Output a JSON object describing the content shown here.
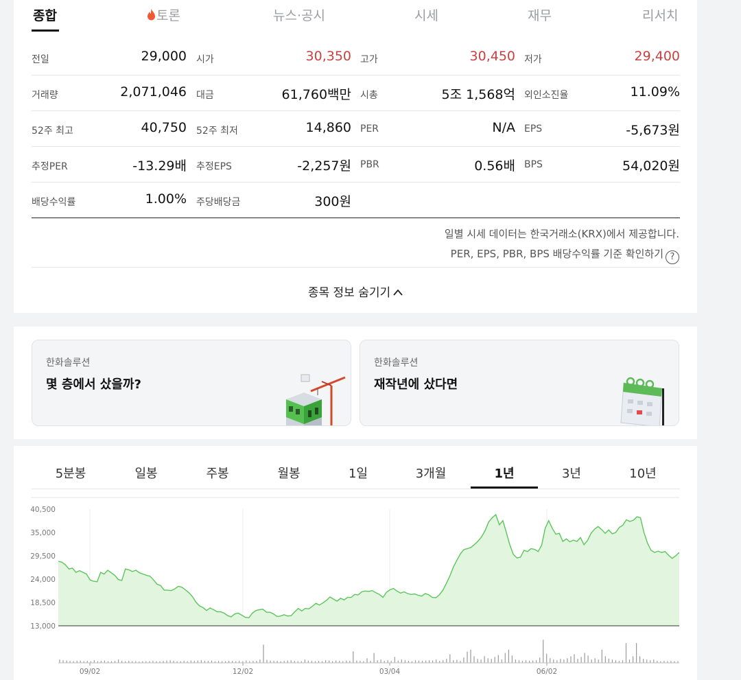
{
  "tabs": [
    {
      "label": "종합",
      "active": true
    },
    {
      "label": "토론",
      "active": false,
      "icon": "fire-icon"
    },
    {
      "label": "뉴스·공시",
      "active": false
    },
    {
      "label": "시세",
      "active": false
    },
    {
      "label": "재무",
      "active": false
    },
    {
      "label": "리서치",
      "active": false
    }
  ],
  "stats": [
    [
      {
        "label": "전일",
        "value": "29,000"
      },
      {
        "label": "시가",
        "value": "30,350",
        "up": true
      },
      {
        "label": "고가",
        "value": "30,450",
        "up": true
      },
      {
        "label": "저가",
        "value": "29,400",
        "up": true
      }
    ],
    [
      {
        "label": "거래량",
        "value": "2,071,046"
      },
      {
        "label": "대금",
        "value": "61,760백만"
      },
      {
        "label": "시총",
        "value": "5조 1,568억"
      },
      {
        "label": "외인소진율",
        "value": "11.09%"
      }
    ],
    [
      {
        "label": "52주 최고",
        "value": "40,750"
      },
      {
        "label": "52주 최저",
        "value": "14,860"
      },
      {
        "label": "PER",
        "value": "N/A"
      },
      {
        "label": "EPS",
        "value": "-5,673원"
      }
    ],
    [
      {
        "label": "추정PER",
        "value": "-13.29배"
      },
      {
        "label": "추정EPS",
        "value": "-2,257원"
      },
      {
        "label": "PBR",
        "value": "0.56배"
      },
      {
        "label": "BPS",
        "value": "54,020원"
      }
    ],
    [
      {
        "label": "배당수익률",
        "value": "1.00%"
      },
      {
        "label": "주당배당금",
        "value": "300원"
      }
    ]
  ],
  "colors": {
    "up": "#c8413f",
    "chart_line": "#5cc55c",
    "chart_fill": "#e1f5df"
  },
  "notes": {
    "source": "일별 시세 데이터는 한국거래소(KRX)에서 제공합니다.",
    "ratio_link": "PER, EPS, PBR, BPS 배당수익률 기준 확인하기",
    "ratio_icon": "question-icon"
  },
  "toggle_label": "종목 정보 숨기기",
  "promos": [
    {
      "brand": "한화솔루션",
      "title": "몇 층에서 샀을까?",
      "icon": "building-crane-icon"
    },
    {
      "brand": "한화솔루션",
      "title": "재작년에 샀다면",
      "icon": "calendar-icon"
    }
  ],
  "period_tabs": [
    {
      "label": "5분봉",
      "active": false
    },
    {
      "label": "일봉",
      "active": false
    },
    {
      "label": "주봉",
      "active": false
    },
    {
      "label": "월봉",
      "active": false
    },
    {
      "label": "1일",
      "active": false
    },
    {
      "label": "3개월",
      "active": false
    },
    {
      "label": "1년",
      "active": true
    },
    {
      "label": "3년",
      "active": false
    },
    {
      "label": "10년",
      "active": false
    }
  ],
  "chart_data": {
    "type": "area",
    "title": "",
    "xlabel": "",
    "ylabel": "",
    "yticks": [
      "40,500",
      "35,000",
      "29,500",
      "24,000",
      "18,500",
      "13,000"
    ],
    "ylim": [
      13000,
      40500
    ],
    "xticks": [
      "09/02",
      "12/02",
      "03/04",
      "06/02"
    ],
    "grid": true,
    "series": [
      {
        "values": [
          28200,
          28000,
          27400,
          26400,
          26600,
          25600,
          26000,
          25600,
          25200,
          23800,
          23500,
          23400,
          25600,
          25200,
          26100,
          25500,
          24900,
          23900,
          23700,
          26400,
          26200,
          25800,
          26100,
          25500,
          25200,
          24900,
          24700,
          23800,
          22800,
          22500,
          21400,
          21400,
          21300,
          21700,
          22300,
          22100,
          21500,
          20800,
          19900,
          18600,
          17700,
          17300,
          16600,
          17200,
          16800,
          16300,
          16300,
          16000,
          15400,
          15100,
          15800,
          16000,
          15500,
          15000,
          14900,
          16000,
          16600,
          16800,
          16900,
          16200,
          16200,
          15800,
          15200,
          15300,
          15600,
          15300,
          15400,
          16300,
          17100,
          16500,
          17100,
          17000,
          17600,
          18300,
          17900,
          18400,
          19000,
          19800,
          19300,
          18800,
          19500,
          19100,
          19700,
          19700,
          20400,
          20300,
          21000,
          21200,
          21100,
          21300,
          20800,
          20400,
          19700,
          20900,
          21500,
          21800,
          21200,
          20700,
          21000,
          20600,
          20400,
          20500,
          20200,
          20000,
          20600,
          20300,
          19700,
          19600,
          20300,
          21400,
          23000,
          24800,
          26900,
          28500,
          30000,
          31000,
          31200,
          31500,
          32200,
          33000,
          34000,
          35500,
          37500,
          38500,
          39200,
          36800,
          37800,
          35000,
          32000,
          29800,
          29000,
          29200,
          30800,
          30500,
          31200,
          31000,
          30500,
          32000,
          36000,
          37800,
          36000,
          34600,
          34800,
          32900,
          33500,
          32800,
          33200,
          32900,
          33800,
          32100,
          33100,
          34800,
          35800,
          36400,
          35700,
          34800,
          35600,
          34700,
          35000,
          36200,
          36700,
          38000,
          37600,
          37900,
          38700,
          38500,
          35000,
          32500,
          30800,
          30300,
          30600,
          30300,
          30500,
          29600,
          28900,
          29500,
          30300
        ]
      }
    ],
    "volume_relative": [
      0.1,
      0.08,
      0.07,
      0.06,
      0.05,
      0.06,
      0.07,
      0.05,
      0.06,
      0.05,
      0.08,
      0.05,
      0.06,
      0.07,
      0.05,
      0.05,
      0.06,
      0.1,
      0.06,
      0.05,
      0.06,
      0.05,
      0.05,
      0.04,
      0.05,
      0.05,
      0.05,
      0.06,
      0.05,
      0.05,
      0.06,
      0.07,
      0.08,
      0.06,
      0.05,
      0.05,
      0.06,
      0.05,
      0.07,
      0.06,
      0.07,
      0.08,
      0.06,
      0.06,
      0.07,
      0.05,
      0.06,
      0.05,
      0.05,
      0.06,
      0.06,
      0.05,
      0.06,
      0.05,
      0.07,
      0.05,
      0.06,
      0.06,
      0.1,
      0.55,
      0.09,
      0.07,
      0.06,
      0.06,
      0.05,
      0.06,
      0.07,
      0.08,
      0.06,
      0.05,
      0.05,
      0.1,
      0.07,
      0.06,
      0.05,
      0.06,
      0.05,
      0.08,
      0.07,
      0.05,
      0.07,
      0.06,
      0.05,
      0.07,
      0.06,
      0.35,
      0.07,
      0.06,
      0.05,
      0.14,
      0.06,
      0.3,
      0.08,
      0.1,
      0.06,
      0.08,
      0.06,
      0.18,
      0.07,
      0.1,
      0.08,
      0.06,
      0.05,
      0.08,
      0.07,
      0.06,
      0.07,
      0.08,
      0.07,
      0.1,
      0.06,
      0.08,
      0.12,
      0.26,
      0.08,
      0.09,
      0.06,
      0.16,
      0.34,
      0.4,
      0.2,
      0.12,
      0.1,
      0.2,
      0.14,
      0.12,
      0.18,
      0.24,
      0.1,
      0.3,
      0.4,
      0.22,
      0.1,
      0.08,
      0.06,
      0.08,
      0.06,
      0.07,
      0.08,
      0.16,
      0.7,
      0.28,
      0.14,
      0.1,
      0.08,
      0.12,
      0.1,
      0.14,
      0.2,
      0.26,
      0.12,
      0.18,
      0.3,
      0.22,
      0.1,
      0.14,
      0.1,
      0.4,
      0.2,
      0.13,
      0.1,
      0.08,
      0.06,
      0.08,
      0.6,
      0.1,
      0.2,
      0.6,
      0.2,
      0.12,
      0.1,
      0.08,
      0.1,
      0.06,
      0.05,
      0.06,
      0.05,
      0.06,
      0.05,
      0.05
    ]
  }
}
